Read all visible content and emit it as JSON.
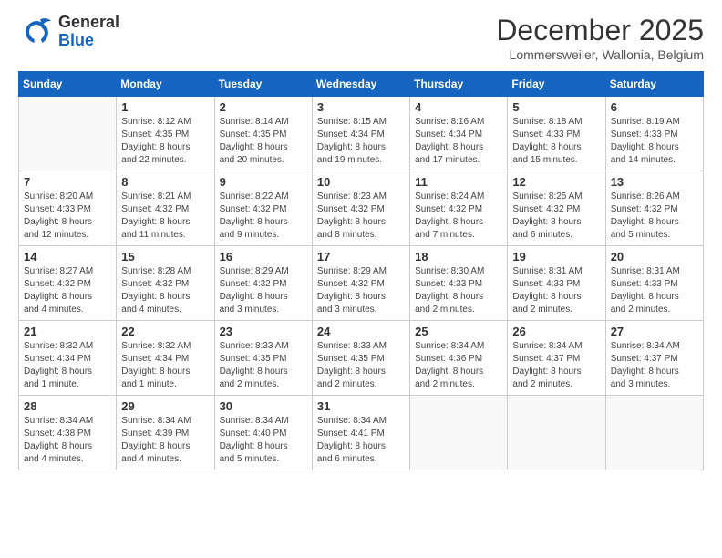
{
  "header": {
    "logo_general": "General",
    "logo_blue": "Blue",
    "month_title": "December 2025",
    "location": "Lommersweiler, Wallonia, Belgium"
  },
  "days_of_week": [
    "Sunday",
    "Monday",
    "Tuesday",
    "Wednesday",
    "Thursday",
    "Friday",
    "Saturday"
  ],
  "weeks": [
    [
      {
        "day": "",
        "info": ""
      },
      {
        "day": "1",
        "info": "Sunrise: 8:12 AM\nSunset: 4:35 PM\nDaylight: 8 hours\nand 22 minutes."
      },
      {
        "day": "2",
        "info": "Sunrise: 8:14 AM\nSunset: 4:35 PM\nDaylight: 8 hours\nand 20 minutes."
      },
      {
        "day": "3",
        "info": "Sunrise: 8:15 AM\nSunset: 4:34 PM\nDaylight: 8 hours\nand 19 minutes."
      },
      {
        "day": "4",
        "info": "Sunrise: 8:16 AM\nSunset: 4:34 PM\nDaylight: 8 hours\nand 17 minutes."
      },
      {
        "day": "5",
        "info": "Sunrise: 8:18 AM\nSunset: 4:33 PM\nDaylight: 8 hours\nand 15 minutes."
      },
      {
        "day": "6",
        "info": "Sunrise: 8:19 AM\nSunset: 4:33 PM\nDaylight: 8 hours\nand 14 minutes."
      }
    ],
    [
      {
        "day": "7",
        "info": "Sunrise: 8:20 AM\nSunset: 4:33 PM\nDaylight: 8 hours\nand 12 minutes."
      },
      {
        "day": "8",
        "info": "Sunrise: 8:21 AM\nSunset: 4:32 PM\nDaylight: 8 hours\nand 11 minutes."
      },
      {
        "day": "9",
        "info": "Sunrise: 8:22 AM\nSunset: 4:32 PM\nDaylight: 8 hours\nand 9 minutes."
      },
      {
        "day": "10",
        "info": "Sunrise: 8:23 AM\nSunset: 4:32 PM\nDaylight: 8 hours\nand 8 minutes."
      },
      {
        "day": "11",
        "info": "Sunrise: 8:24 AM\nSunset: 4:32 PM\nDaylight: 8 hours\nand 7 minutes."
      },
      {
        "day": "12",
        "info": "Sunrise: 8:25 AM\nSunset: 4:32 PM\nDaylight: 8 hours\nand 6 minutes."
      },
      {
        "day": "13",
        "info": "Sunrise: 8:26 AM\nSunset: 4:32 PM\nDaylight: 8 hours\nand 5 minutes."
      }
    ],
    [
      {
        "day": "14",
        "info": "Sunrise: 8:27 AM\nSunset: 4:32 PM\nDaylight: 8 hours\nand 4 minutes."
      },
      {
        "day": "15",
        "info": "Sunrise: 8:28 AM\nSunset: 4:32 PM\nDaylight: 8 hours\nand 4 minutes."
      },
      {
        "day": "16",
        "info": "Sunrise: 8:29 AM\nSunset: 4:32 PM\nDaylight: 8 hours\nand 3 minutes."
      },
      {
        "day": "17",
        "info": "Sunrise: 8:29 AM\nSunset: 4:32 PM\nDaylight: 8 hours\nand 3 minutes."
      },
      {
        "day": "18",
        "info": "Sunrise: 8:30 AM\nSunset: 4:33 PM\nDaylight: 8 hours\nand 2 minutes."
      },
      {
        "day": "19",
        "info": "Sunrise: 8:31 AM\nSunset: 4:33 PM\nDaylight: 8 hours\nand 2 minutes."
      },
      {
        "day": "20",
        "info": "Sunrise: 8:31 AM\nSunset: 4:33 PM\nDaylight: 8 hours\nand 2 minutes."
      }
    ],
    [
      {
        "day": "21",
        "info": "Sunrise: 8:32 AM\nSunset: 4:34 PM\nDaylight: 8 hours\nand 1 minute."
      },
      {
        "day": "22",
        "info": "Sunrise: 8:32 AM\nSunset: 4:34 PM\nDaylight: 8 hours\nand 1 minute."
      },
      {
        "day": "23",
        "info": "Sunrise: 8:33 AM\nSunset: 4:35 PM\nDaylight: 8 hours\nand 2 minutes."
      },
      {
        "day": "24",
        "info": "Sunrise: 8:33 AM\nSunset: 4:35 PM\nDaylight: 8 hours\nand 2 minutes."
      },
      {
        "day": "25",
        "info": "Sunrise: 8:34 AM\nSunset: 4:36 PM\nDaylight: 8 hours\nand 2 minutes."
      },
      {
        "day": "26",
        "info": "Sunrise: 8:34 AM\nSunset: 4:37 PM\nDaylight: 8 hours\nand 2 minutes."
      },
      {
        "day": "27",
        "info": "Sunrise: 8:34 AM\nSunset: 4:37 PM\nDaylight: 8 hours\nand 3 minutes."
      }
    ],
    [
      {
        "day": "28",
        "info": "Sunrise: 8:34 AM\nSunset: 4:38 PM\nDaylight: 8 hours\nand 4 minutes."
      },
      {
        "day": "29",
        "info": "Sunrise: 8:34 AM\nSunset: 4:39 PM\nDaylight: 8 hours\nand 4 minutes."
      },
      {
        "day": "30",
        "info": "Sunrise: 8:34 AM\nSunset: 4:40 PM\nDaylight: 8 hours\nand 5 minutes."
      },
      {
        "day": "31",
        "info": "Sunrise: 8:34 AM\nSunset: 4:41 PM\nDaylight: 8 hours\nand 6 minutes."
      },
      {
        "day": "",
        "info": ""
      },
      {
        "day": "",
        "info": ""
      },
      {
        "day": "",
        "info": ""
      }
    ]
  ]
}
